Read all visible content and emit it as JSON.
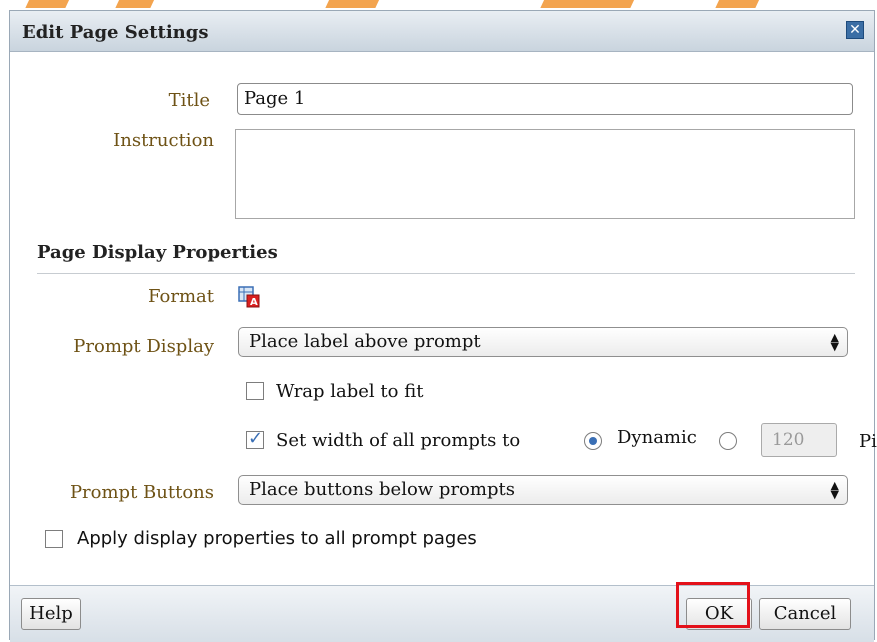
{
  "dialog": {
    "title": "Edit Page Settings",
    "close_icon": "close-icon"
  },
  "fields": {
    "title_label": "Title",
    "title_value": "Page 1",
    "instruction_label": "Instruction",
    "instruction_value": ""
  },
  "display_properties": {
    "section_title": "Page Display Properties",
    "format_label": "Format",
    "format_icon": "format-icon",
    "prompt_display_label": "Prompt Display",
    "prompt_display_value": "Place label above prompt",
    "wrap_label": "Wrap label to fit",
    "wrap_checked": false,
    "set_width_label": "Set width of all prompts to",
    "set_width_checked": true,
    "dynamic_label": "Dynamic",
    "dynamic_selected": true,
    "pixels_value": "120",
    "pixels_unit": "Pi",
    "prompt_buttons_label": "Prompt Buttons",
    "prompt_buttons_value": "Place buttons below prompts",
    "apply_all_label": "Apply display properties to all prompt pages",
    "apply_all_checked": false
  },
  "footer": {
    "help_label": "Help",
    "ok_label": "OK",
    "cancel_label": "Cancel"
  },
  "colors": {
    "label_color": "#6e5215",
    "accent_blue": "#3a6fb5",
    "highlight_red": "#e3111a",
    "background_orange": "#f29a3c"
  }
}
